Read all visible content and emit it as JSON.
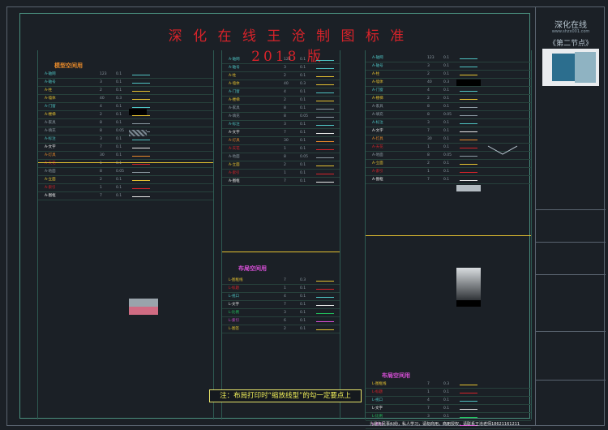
{
  "title": "深 化 在 线 王 沧 制 图 标 准 2018 版",
  "colors": {
    "background": "#1b2026",
    "title": "#d8232a",
    "accent_cyan": "#4ec3c3",
    "accent_yellow": "#e5c230",
    "highlight_magenta": "#d94fd8"
  },
  "sections": {
    "model_space": "模型空间用",
    "layout_space": "布局空间用",
    "layout_space_2": "布局空间用"
  },
  "col1_rows": [
    {
      "name": "A-轴网",
      "val": "123",
      "w": "0.1",
      "line": "#4ec3c3"
    },
    {
      "name": "A-轴号",
      "val": "3",
      "w": "0.1",
      "line": "#4ec3c3"
    },
    {
      "name": "A-柱",
      "val": "2",
      "w": "0.1",
      "line": "#e5c230"
    },
    {
      "name": "A-墙体",
      "val": "40",
      "w": "0.3",
      "line": "#e5c230"
    },
    {
      "name": "A-门窗",
      "val": "4",
      "w": "0.1",
      "line": "#4ec3c3"
    },
    {
      "name": "A-楼梯",
      "val": "2",
      "w": "0.1",
      "line": "#e5c230"
    },
    {
      "name": "A-家具",
      "val": "8",
      "w": "0.1",
      "line": "#8c9aa3"
    },
    {
      "name": "A-填充",
      "val": "8",
      "w": "0.05",
      "line": "#8c9aa3"
    },
    {
      "name": "A-标注",
      "val": "3",
      "w": "0.1",
      "line": "#4ec3c3"
    },
    {
      "name": "A-文字",
      "val": "7",
      "w": "0.1",
      "line": "#e8e8e8"
    },
    {
      "name": "A-灯具",
      "val": "30",
      "w": "0.1",
      "line": "#e88a2a"
    },
    {
      "name": "A-天花",
      "val": "1",
      "w": "0.1",
      "line": "#d8232a"
    },
    {
      "name": "A-地面",
      "val": "8",
      "w": "0.05",
      "line": "#8c9aa3"
    },
    {
      "name": "A-立面",
      "val": "2",
      "w": "0.1",
      "line": "#e5c230"
    },
    {
      "name": "A-索引",
      "val": "1",
      "w": "0.1",
      "line": "#d8232a"
    },
    {
      "name": "A-图框",
      "val": "7",
      "w": "0.1",
      "line": "#e8e8e8"
    }
  ],
  "col2_rows": [
    {
      "name": "L-图框线",
      "val": "7",
      "w": "0.3",
      "line": "#e5c230"
    },
    {
      "name": "L-标题",
      "val": "1",
      "w": "0.1",
      "line": "#d8232a"
    },
    {
      "name": "L-视口",
      "val": "4",
      "w": "0.1",
      "line": "#4ec3c3"
    },
    {
      "name": "L-文字",
      "val": "7",
      "w": "0.1",
      "line": "#e8e8e8"
    },
    {
      "name": "L-比例",
      "val": "3",
      "w": "0.1",
      "line": "#22c55e"
    },
    {
      "name": "L-索引",
      "val": "6",
      "w": "0.1",
      "line": "#d94fd8"
    },
    {
      "name": "L-图签",
      "val": "2",
      "w": "0.1",
      "line": "#e5c230"
    }
  ],
  "note": "注：布局打印时“缩放线型”的勾一定要点上",
  "titleblock": {
    "brand": "深化在线",
    "url": "www.shzx001.com",
    "node": "《第二节点》",
    "footer": "为避免民事纠纷，私人学习，请勿商用，商用授权，请联系王沧老师18621161211"
  }
}
